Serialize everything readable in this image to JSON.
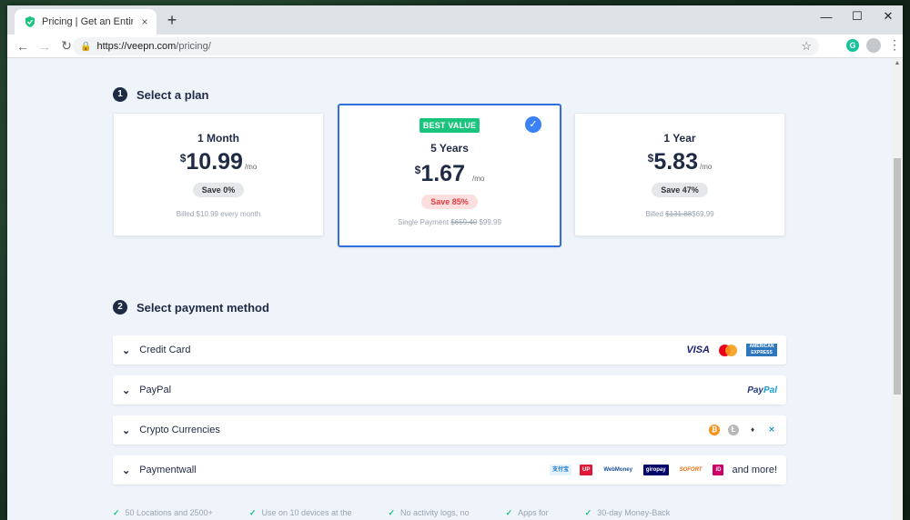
{
  "browser": {
    "tab_title": "Pricing | Get an Entire Month of",
    "tab_close": "×",
    "new_tab": "+",
    "url_host": "https://veepn.com",
    "url_path": "/pricing/",
    "ext_letter": "G",
    "window_minimize": "—",
    "window_maximize": "☐",
    "window_close": "✕"
  },
  "step1": {
    "num": "1",
    "title": "Select a plan"
  },
  "step2": {
    "num": "2",
    "title": "Select payment method"
  },
  "plans": [
    {
      "name": "1 Month",
      "currency": "$",
      "amount": "10.99",
      "per": "/mo",
      "save": "Save 0%",
      "billed": "Billed $10.99 every month"
    },
    {
      "badge": "BEST VALUE",
      "name": "5 Years",
      "currency": "$",
      "amount": "1.67",
      "per": "/mo",
      "save": "Save 85%",
      "billed_prefix": "Single Payment",
      "billed_old": "$659.40",
      "billed_new": "$99.99",
      "check": "✓"
    },
    {
      "name": "1 Year",
      "currency": "$",
      "amount": "5.83",
      "per": "/mo",
      "save": "Save 47%",
      "billed_prefix": "Billed",
      "billed_old": "$131.88",
      "billed_new": "$69.99"
    }
  ],
  "payment_methods": [
    {
      "label": "Credit Card"
    },
    {
      "label": "PayPal"
    },
    {
      "label": "Crypto Currencies"
    },
    {
      "label": "Paymentwall"
    }
  ],
  "logos": {
    "visa": "VISA",
    "amex": "AMERICAN EXPRESS",
    "paypal_a": "Pay",
    "paypal_b": "Pal",
    "btc": "₿",
    "ltc": "Ł",
    "eth": "♦",
    "xrp": "✕",
    "alipay": "支付宝",
    "unionpay": "UP",
    "webmoney": "WebMoney",
    "giropay": "giropay",
    "sofort": "SOFORT",
    "ideal": "iD",
    "more": "and more!"
  },
  "features": [
    "50 Locations and 2500+",
    "Use on 10 devices at the",
    "No activity logs, no",
    "Apps for",
    "30-day Money-Back"
  ]
}
